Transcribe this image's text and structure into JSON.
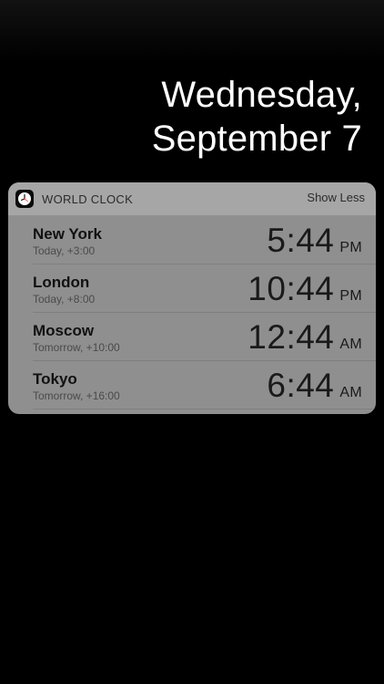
{
  "lock_screen": {
    "date_line1": "Wednesday,",
    "date_line2": "September 7"
  },
  "widget": {
    "title": "WORLD CLOCK",
    "action_label": "Show Less",
    "icon": "clock-icon",
    "clocks": [
      {
        "city": "New York",
        "offset": "Today, +3:00",
        "time": "5:44",
        "ampm": "PM"
      },
      {
        "city": "London",
        "offset": "Today, +8:00",
        "time": "10:44",
        "ampm": "PM"
      },
      {
        "city": "Moscow",
        "offset": "Tomorrow, +10:00",
        "time": "12:44",
        "ampm": "AM"
      },
      {
        "city": "Tokyo",
        "offset": "Tomorrow, +16:00",
        "time": "6:44",
        "ampm": "AM"
      }
    ]
  },
  "colors": {
    "background": "#000000",
    "widget_body": "#8f8f8f",
    "widget_header": "#a6a6a6",
    "text_dark": "#111111"
  }
}
